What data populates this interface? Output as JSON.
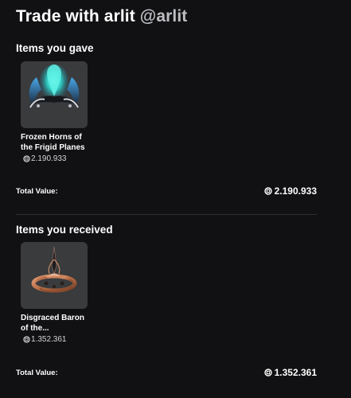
{
  "trade": {
    "title_prefix": "Trade with arlit",
    "handle": "@arlit"
  },
  "gave": {
    "heading": "Items you gave",
    "items": [
      {
        "name": "Frozen Horns of the Frigid Planes",
        "price": "2.190.933",
        "icon": "frozen-horns-thumbnail"
      }
    ],
    "total_label": "Total Value:",
    "total_value": "2.190.933"
  },
  "received": {
    "heading": "Items you received",
    "items": [
      {
        "name": "Disgraced Baron of the...",
        "price": "1.352.361",
        "icon": "disgraced-baron-thumbnail"
      }
    ],
    "total_label": "Total Value:",
    "total_value": "1.352.361"
  },
  "colors": {
    "background": "#111113",
    "thumb_background": "#393b3d",
    "handle": "#bdbec2",
    "divider": "#2e2f32"
  },
  "icons": {
    "currency": "robux-icon"
  }
}
